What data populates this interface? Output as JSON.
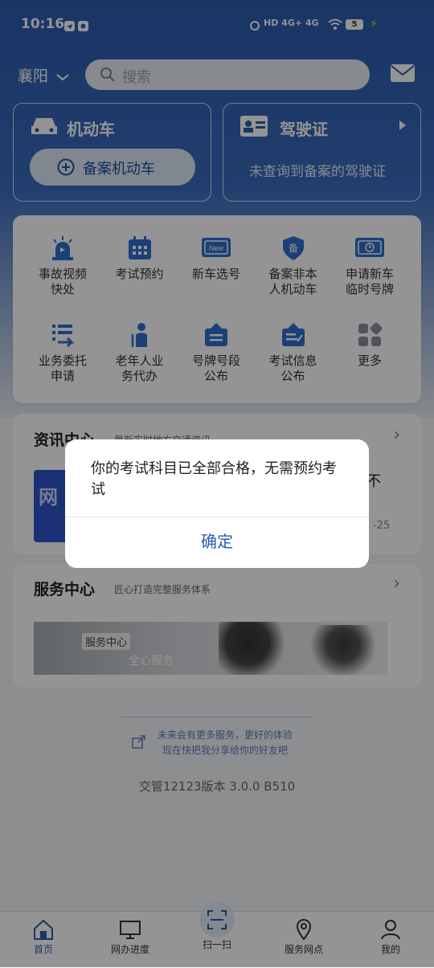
{
  "status_bar": {
    "time": "10:16",
    "battery": "5",
    "net": "HD 4G+ 4G"
  },
  "header": {
    "city": "襄阳",
    "search_placeholder": "搜索"
  },
  "vehicle_card": {
    "title": "机动车",
    "button": "备案机动车"
  },
  "license_card": {
    "title": "驾驶证",
    "note": "未查询到备案的驾驶证"
  },
  "services": [
    {
      "label": "事故视频快处",
      "line1": "事故视频",
      "line2": "快处",
      "icon": "alarm-siren-icon"
    },
    {
      "label": "考试预约",
      "line1": "考试预约",
      "line2": "",
      "icon": "calendar-icon"
    },
    {
      "label": "新车选号",
      "line1": "新车选号",
      "line2": "",
      "icon": "new-plate-icon"
    },
    {
      "label": "备案非本人机动车",
      "line1": "备案非本",
      "line2": "人机动车",
      "icon": "shield-icon"
    },
    {
      "label": "申请新车临时号牌",
      "line1": "申请新车",
      "line2": "临时号牌",
      "icon": "temp-plate-icon"
    },
    {
      "label": "业务委托申请",
      "line1": "业务委托",
      "line2": "申请",
      "icon": "list-arrow-icon"
    },
    {
      "label": "老年人业务代办",
      "line1": "老年人业",
      "line2": "务代办",
      "icon": "elder-icon"
    },
    {
      "label": "号牌号段公布",
      "line1": "号牌号段",
      "line2": "公布",
      "icon": "notice-board-icon"
    },
    {
      "label": "考试信息公布",
      "line1": "考试信息",
      "line2": "公布",
      "icon": "exam-board-icon"
    },
    {
      "label": "更多",
      "line1": "更多",
      "line2": "",
      "icon": "more-apps-icon"
    }
  ],
  "news": {
    "title": "资讯中心",
    "subtitle": "最新实时地方交通资讯",
    "partial_text": "不",
    "partial_date": "-25",
    "thumb_text": "网"
  },
  "service_center": {
    "title": "服务中心",
    "subtitle": "匠心打造完整服务体系",
    "banner_tag": "服务中心",
    "banner_text": "全心服务"
  },
  "share": {
    "line1": "未来会有更多服务，更好的体验",
    "line2": "现在快把我分享给你的好友吧"
  },
  "version": "交管12123版本 3.0.0 B510",
  "tabs": [
    {
      "label": "首页",
      "icon": "home-icon"
    },
    {
      "label": "网办进度",
      "icon": "monitor-icon"
    },
    {
      "label": "扫一扫",
      "icon": "scan-icon"
    },
    {
      "label": "服务网点",
      "icon": "location-icon"
    },
    {
      "label": "我的",
      "icon": "user-icon"
    }
  ],
  "dialog": {
    "message": "你的考试科目已全部合格，无需预约考试",
    "confirm": "确定"
  },
  "colors": {
    "primary": "#2a5cae",
    "accent_orange": "#f08c00"
  }
}
